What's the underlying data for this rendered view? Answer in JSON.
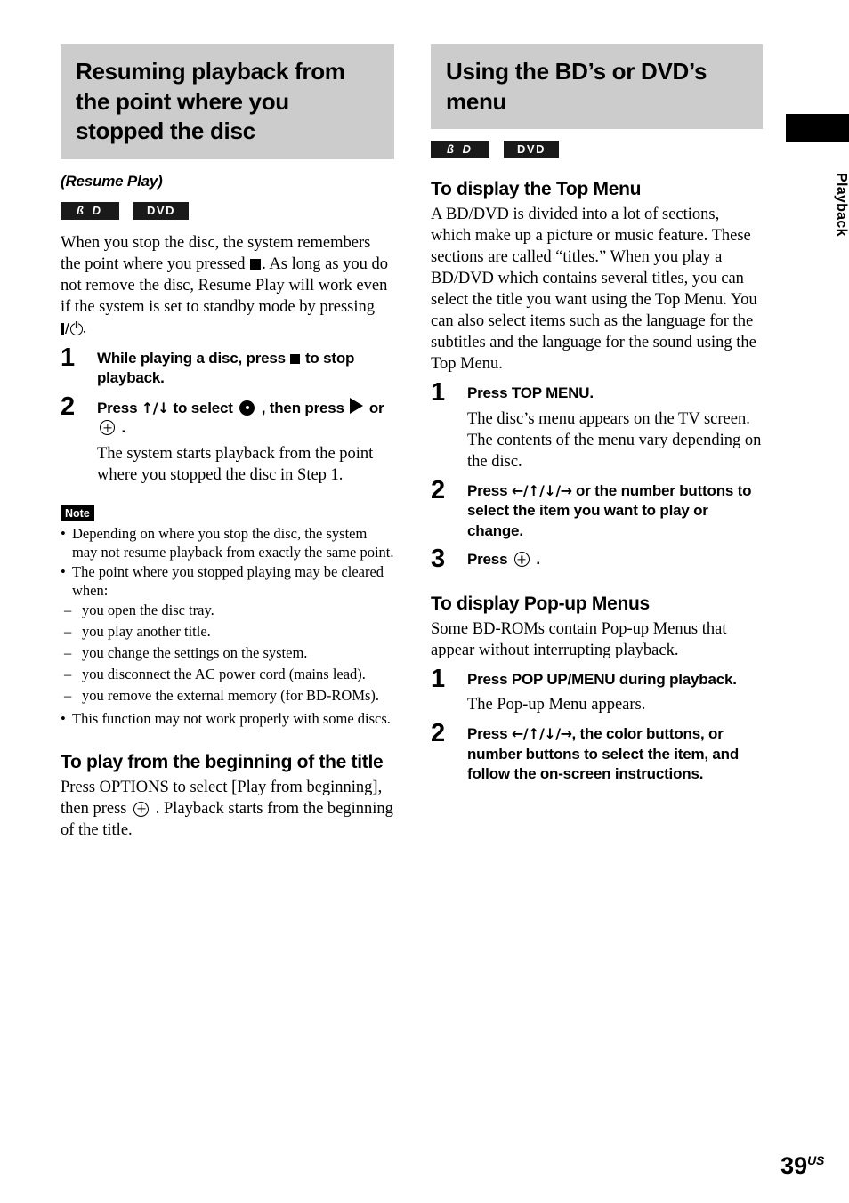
{
  "page": {
    "number": "39",
    "region_suffix": "US",
    "edge_tab_label": "Playback"
  },
  "badges": {
    "bd": "ß D",
    "dvd": "DVD"
  },
  "left_column": {
    "section_heading": "Resuming playback from the point where you stopped the disc",
    "subtitle": "(Resume Play)",
    "intro_parts": {
      "p1": "When you stop the disc, the system remembers the point where you pressed ",
      "p2": ". As long as you do not remove the disc, Resume Play will work even if the system is set to standby mode by pressing ",
      "p3": "."
    },
    "steps": [
      {
        "num": "1",
        "instr_parts": {
          "a": "While playing a disc, press ",
          "b": " to stop playback."
        },
        "sub": ""
      },
      {
        "num": "2",
        "instr_parts": {
          "a": "Press ",
          "arrows": "↑/↓",
          "b": " to select ",
          "c": " , then press ",
          "d": " or ",
          "e": " ."
        },
        "sub": "The system starts playback from the point where you stopped the disc in Step 1."
      }
    ],
    "note": {
      "tag": "Note",
      "bullets": [
        "Depending on where you stop the disc, the system may not resume playback from exactly the same point.",
        "The point where you stopped playing may be cleared when:",
        "This function may not work properly with some discs."
      ],
      "sub_bullets": [
        "you open the disc tray.",
        "you play another title.",
        "you change the settings on the system.",
        "you disconnect the AC power cord (mains lead).",
        "you remove the external memory (for BD-ROMs)."
      ]
    },
    "play_from_beginning": {
      "heading": "To play from the beginning of the title",
      "body_parts": {
        "a": "Press OPTIONS to select [Play from beginning], then press ",
        "b": " . Playback starts from the beginning of the title."
      }
    }
  },
  "right_column": {
    "section_heading": "Using the BD’s or DVD’s menu",
    "top_menu": {
      "heading": "To display the Top Menu",
      "body": "A BD/DVD is divided into a lot of sections, which make up a picture or music feature. These sections are called “titles.” When you play a BD/DVD which contains several titles, you can select the title you want using the Top Menu. You can also select items such as the language for the subtitles and the language for the sound using the Top Menu.",
      "steps": [
        {
          "num": "1",
          "instr": "Press TOP MENU.",
          "sub": "The disc’s menu appears on the TV screen. The contents of the menu vary depending on the disc."
        },
        {
          "num": "2",
          "instr_parts": {
            "a": "Press ",
            "arrows": "←/↑/↓/→",
            "b": " or the number buttons to select the item you want to play or change."
          },
          "sub": ""
        },
        {
          "num": "3",
          "instr_parts": {
            "a": "Press ",
            "b": " ."
          },
          "sub": ""
        }
      ]
    },
    "popup_menus": {
      "heading": "To display Pop-up Menus",
      "body": "Some BD-ROMs contain Pop-up Menus that appear without interrupting playback.",
      "steps": [
        {
          "num": "1",
          "instr": "Press POP UP/MENU during playback.",
          "sub": "The Pop-up Menu appears."
        },
        {
          "num": "2",
          "instr_parts": {
            "a": "Press ",
            "arrows": "←/↑/↓/→",
            "b": ", the color buttons, or number buttons to select the item, and follow the on-screen instructions."
          },
          "sub": ""
        }
      ]
    }
  },
  "colors": {
    "section_header_bg": "#cccccc",
    "badge_bg": "#1a1a1a",
    "tab_bg": "#000000"
  }
}
